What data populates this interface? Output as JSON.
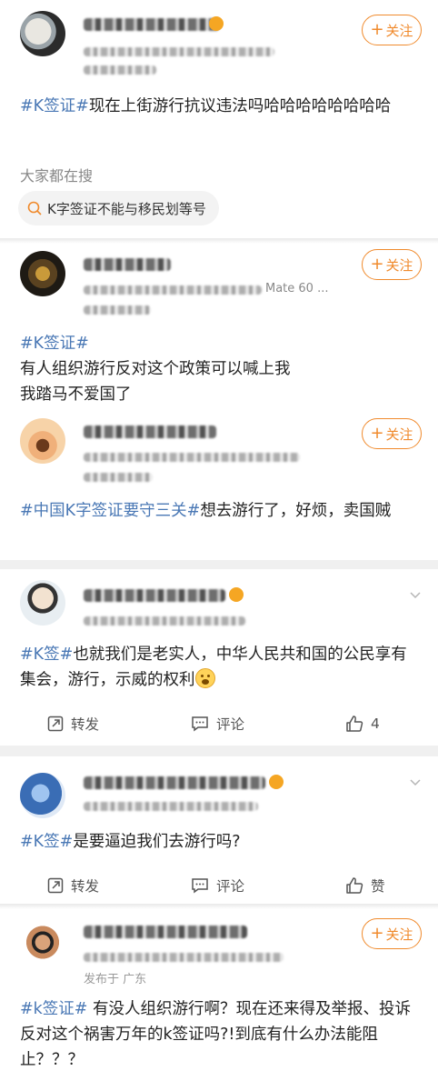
{
  "follow_label": "关注",
  "posts": [
    {
      "tag": "#K签证#",
      "text": "现在上街游行抗议违法吗哈哈哈哈哈哈哈哈",
      "search_label": "大家都在搜",
      "search_chip": "K字签证不能与移民划等号"
    },
    {
      "tag": "#K签证#",
      "line1": "有人组织游行反对这个政策可以喊上我",
      "line2": "我踏马不爱国了",
      "meta_visible": "Mate 60 ..."
    },
    {
      "tag": "#中国K字签证要守三关#",
      "text": "想去游行了，好烦，卖国贼"
    },
    {
      "tag": "#K签#",
      "text": "也就我们是老实人，中华人民共和国的公民享有集会，游行，示威的权利",
      "actions": {
        "repost": "转发",
        "comment": "评论",
        "like": "4"
      }
    },
    {
      "tag": "#K签#",
      "text": "是要逼迫我们去游行吗?",
      "actions": {
        "repost": "转发",
        "comment": "评论",
        "like": "赞"
      }
    },
    {
      "tag": "#k签证#",
      "text": " 有没人组织游行啊？现在还来得及举报、投诉反对这个祸害万年的k签证吗?!到底有什么办法能阻止？？？",
      "meta_visible": "发布于 广东"
    }
  ]
}
